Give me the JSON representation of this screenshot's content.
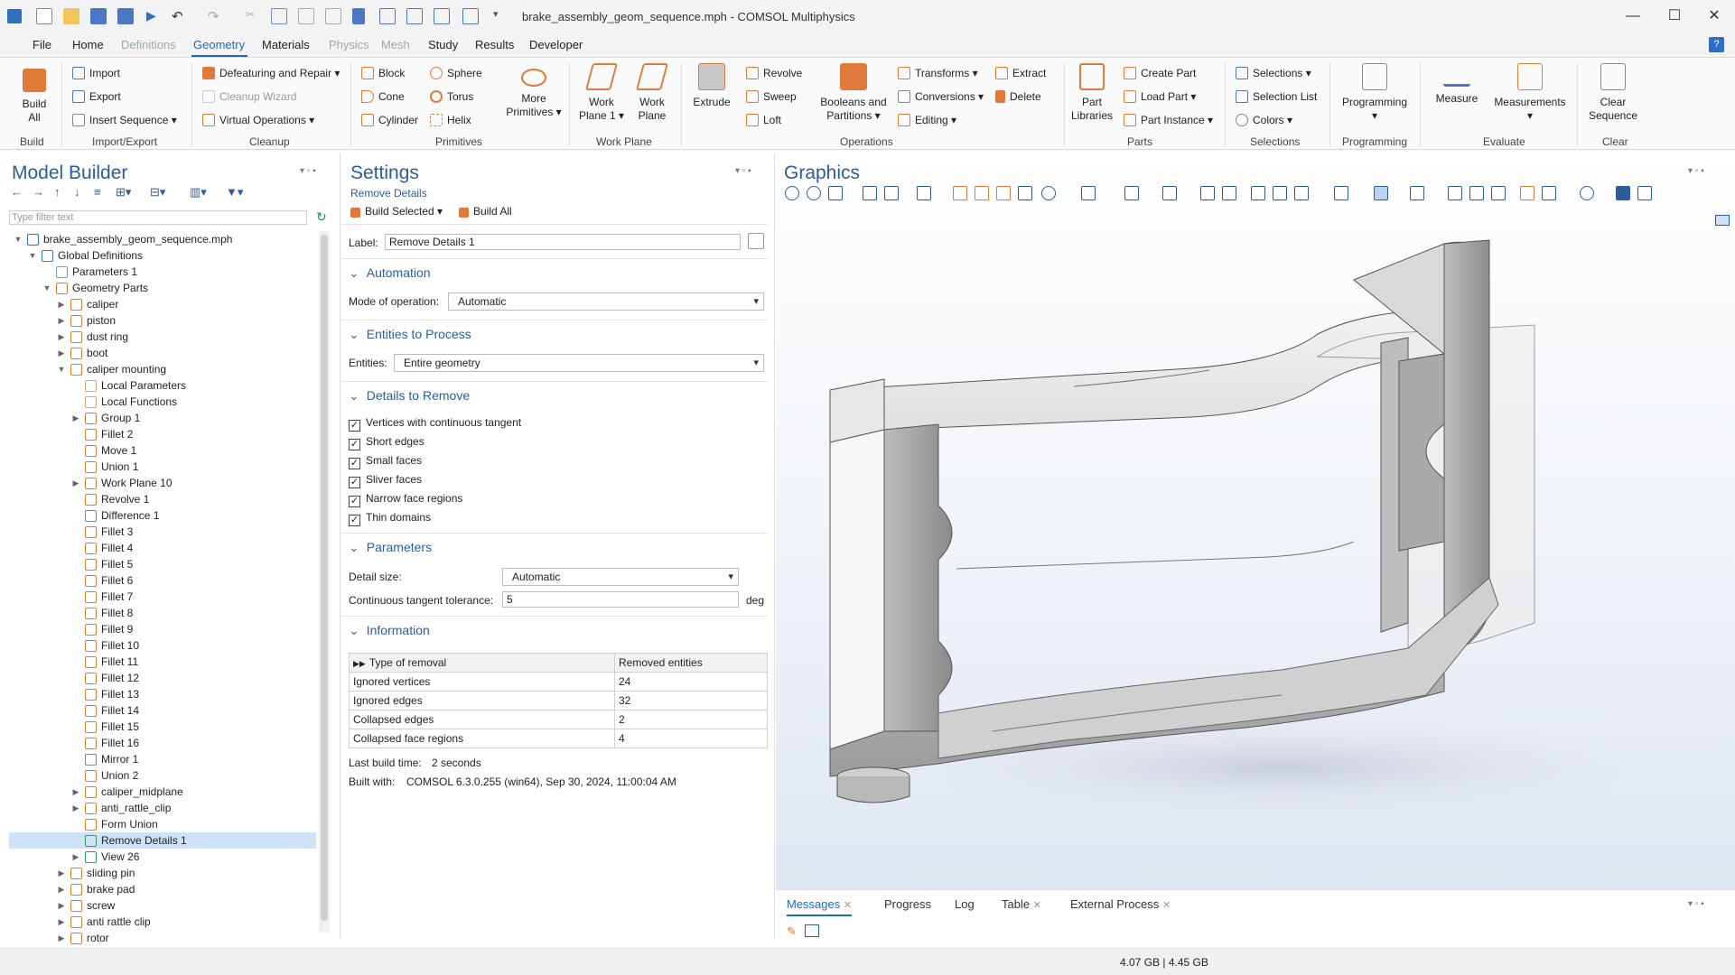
{
  "window": {
    "title": "brake_assembly_geom_sequence.mph - COMSOL Multiphysics"
  },
  "menu": [
    "File",
    "Home",
    "Definitions",
    "Geometry",
    "Materials",
    "Physics",
    "Mesh",
    "Study",
    "Results",
    "Developer"
  ],
  "ribbon": {
    "build": {
      "build_all": "Build\nAll",
      "group": "Build"
    },
    "import_export": {
      "import": "Import",
      "export": "Export",
      "insert_sequence": "Insert Sequence",
      "group": "Import/Export"
    },
    "cleanup": {
      "defeaturing": "Defeaturing and Repair",
      "cleanup_wizard": "Cleanup Wizard",
      "virtual_operations": "Virtual Operations",
      "group": "Cleanup"
    },
    "primitives": {
      "block": "Block",
      "cone": "Cone",
      "cylinder": "Cylinder",
      "sphere": "Sphere",
      "torus": "Torus",
      "helix": "Helix",
      "more": "More\nPrimitives",
      "group": "Primitives"
    },
    "work_plane": {
      "wp1": "Work\nPlane 1",
      "wp": "Work\nPlane",
      "group": "Work Plane"
    },
    "operations": {
      "extrude": "Extrude",
      "revolve": "Revolve",
      "sweep": "Sweep",
      "loft": "Loft",
      "booleans": "Booleans and\nPartitions",
      "transforms": "Transforms",
      "conversions": "Conversions",
      "editing": "Editing",
      "extract": "Extract",
      "delete": "Delete",
      "group": "Operations"
    },
    "parts": {
      "part_libraries": "Part\nLibraries",
      "create_part": "Create Part",
      "load_part": "Load Part",
      "part_instance": "Part Instance",
      "group": "Parts"
    },
    "selections": {
      "selections": "Selections",
      "selection_list": "Selection List",
      "colors": "Colors",
      "group": "Selections"
    },
    "programming": {
      "programming": "Programming",
      "group": "Programming"
    },
    "evaluate": {
      "measure": "Measure",
      "measurements": "Measurements",
      "group": "Evaluate"
    },
    "clear": {
      "clear_sequence": "Clear\nSequence",
      "group": "Clear"
    }
  },
  "model_builder": {
    "title": "Model Builder",
    "filter_placeholder": "Type filter text",
    "tree": [
      {
        "label": "brake_assembly_geom_sequence.mph",
        "indent": 0,
        "exp": "open",
        "icon": "#2e6fc4"
      },
      {
        "label": "Global Definitions",
        "indent": 1,
        "exp": "open",
        "icon": "#3a7bd5"
      },
      {
        "label": "Parameters 1",
        "indent": 2,
        "exp": "",
        "icon": "#7a9cc9"
      },
      {
        "label": "Geometry Parts",
        "indent": 2,
        "exp": "open",
        "icon": "#e07a3a"
      },
      {
        "label": "caliper",
        "indent": 3,
        "exp": "closed",
        "icon": "#e07a3a"
      },
      {
        "label": "piston",
        "indent": 3,
        "exp": "closed",
        "icon": "#e07a3a"
      },
      {
        "label": "dust ring",
        "indent": 3,
        "exp": "closed",
        "icon": "#e07a3a"
      },
      {
        "label": "boot",
        "indent": 3,
        "exp": "closed",
        "icon": "#e07a3a"
      },
      {
        "label": "caliper mounting",
        "indent": 3,
        "exp": "open",
        "icon": "#e07a3a"
      },
      {
        "label": "Local Parameters",
        "indent": 4,
        "exp": "",
        "icon": "#e0a07a"
      },
      {
        "label": "Local Functions",
        "indent": 4,
        "exp": "",
        "icon": "#e0a07a"
      },
      {
        "label": "Group 1",
        "indent": 4,
        "exp": "closed",
        "icon": "#e07a3a"
      },
      {
        "label": "Fillet 2",
        "indent": 4,
        "exp": "",
        "icon": "#e07a3a"
      },
      {
        "label": "Move 1",
        "indent": 4,
        "exp": "",
        "icon": "#e07a3a"
      },
      {
        "label": "Union 1",
        "indent": 4,
        "exp": "",
        "icon": "#e07a3a"
      },
      {
        "label": "Work Plane 10",
        "indent": 4,
        "exp": "closed",
        "icon": "#e07a3a"
      },
      {
        "label": "Revolve 1",
        "indent": 4,
        "exp": "",
        "icon": "#e07a3a"
      },
      {
        "label": "Difference 1",
        "indent": 4,
        "exp": "",
        "icon": "#888888"
      },
      {
        "label": "Fillet 3",
        "indent": 4,
        "exp": "",
        "icon": "#e07a3a"
      },
      {
        "label": "Fillet 4",
        "indent": 4,
        "exp": "",
        "icon": "#e07a3a"
      },
      {
        "label": "Fillet 5",
        "indent": 4,
        "exp": "",
        "icon": "#e07a3a"
      },
      {
        "label": "Fillet 6",
        "indent": 4,
        "exp": "",
        "icon": "#e07a3a"
      },
      {
        "label": "Fillet 7",
        "indent": 4,
        "exp": "",
        "icon": "#e07a3a"
      },
      {
        "label": "Fillet 8",
        "indent": 4,
        "exp": "",
        "icon": "#e07a3a"
      },
      {
        "label": "Fillet 9",
        "indent": 4,
        "exp": "",
        "icon": "#e07a3a"
      },
      {
        "label": "Fillet 10",
        "indent": 4,
        "exp": "",
        "icon": "#e07a3a"
      },
      {
        "label": "Fillet 11",
        "indent": 4,
        "exp": "",
        "icon": "#e07a3a"
      },
      {
        "label": "Fillet 12",
        "indent": 4,
        "exp": "",
        "icon": "#e07a3a"
      },
      {
        "label": "Fillet 13",
        "indent": 4,
        "exp": "",
        "icon": "#e07a3a"
      },
      {
        "label": "Fillet 14",
        "indent": 4,
        "exp": "",
        "icon": "#e07a3a"
      },
      {
        "label": "Fillet 15",
        "indent": 4,
        "exp": "",
        "icon": "#e07a3a"
      },
      {
        "label": "Fillet 16",
        "indent": 4,
        "exp": "",
        "icon": "#e07a3a"
      },
      {
        "label": "Mirror 1",
        "indent": 4,
        "exp": "",
        "icon": "#888888"
      },
      {
        "label": "Union 2",
        "indent": 4,
        "exp": "",
        "icon": "#e07a3a"
      },
      {
        "label": "caliper_midplane",
        "indent": 4,
        "exp": "closed",
        "icon": "#e07a3a"
      },
      {
        "label": "anti_rattle_clip",
        "indent": 4,
        "exp": "closed",
        "icon": "#e07a3a"
      },
      {
        "label": "Form Union",
        "indent": 4,
        "exp": "",
        "icon": "#e07a3a"
      },
      {
        "label": "Remove Details 1",
        "indent": 4,
        "exp": "",
        "icon": "#3a9a5a",
        "selected": true
      },
      {
        "label": "View 26",
        "indent": 4,
        "exp": "closed",
        "icon": "#3a9a5a"
      },
      {
        "label": "sliding pin",
        "indent": 3,
        "exp": "closed",
        "icon": "#e07a3a"
      },
      {
        "label": "brake pad",
        "indent": 3,
        "exp": "closed",
        "icon": "#e07a3a"
      },
      {
        "label": "screw",
        "indent": 3,
        "exp": "closed",
        "icon": "#e07a3a"
      },
      {
        "label": "anti rattle clip",
        "indent": 3,
        "exp": "closed",
        "icon": "#e07a3a"
      },
      {
        "label": "rotor",
        "indent": 3,
        "exp": "closed",
        "icon": "#e07a3a"
      }
    ]
  },
  "settings": {
    "title": "Settings",
    "subtitle": "Remove Details",
    "build_selected": "Build Selected",
    "build_all": "Build All",
    "label_caption": "Label:",
    "label_value": "Remove Details 1",
    "automation": {
      "heading": "Automation",
      "mode_caption": "Mode of operation:",
      "mode_value": "Automatic"
    },
    "entities": {
      "heading": "Entities to Process",
      "caption": "Entities:",
      "value": "Entire geometry"
    },
    "details": {
      "heading": "Details to Remove",
      "items": [
        "Vertices with continuous tangent",
        "Short edges",
        "Small faces",
        "Sliver faces",
        "Narrow face regions",
        "Thin domains"
      ]
    },
    "parameters": {
      "heading": "Parameters",
      "detail_size_caption": "Detail size:",
      "detail_size_value": "Automatic",
      "tolerance_caption": "Continuous tangent tolerance:",
      "tolerance_value": "5",
      "tolerance_unit": "deg"
    },
    "information": {
      "heading": "Information",
      "columns": [
        "Type of removal",
        "Removed entities"
      ],
      "rows": [
        [
          "Ignored vertices",
          "24"
        ],
        [
          "Ignored edges",
          "32"
        ],
        [
          "Collapsed edges",
          "2"
        ],
        [
          "Collapsed face regions",
          "4"
        ]
      ],
      "last_build_caption": "Last build time:",
      "last_build_value": "2 seconds",
      "built_with_caption": "Built with:",
      "built_with_value": "COMSOL 6.3.0.255 (win64), Sep 30, 2024, 11:00:04 AM"
    }
  },
  "graphics": {
    "title": "Graphics"
  },
  "messages": {
    "tabs": [
      "Messages",
      "Progress",
      "Log",
      "Table",
      "External Process"
    ]
  },
  "status": {
    "memory": "4.07 GB | 4.45 GB"
  },
  "colors": {
    "accent": "#2a5d9b",
    "selection": "#cfe3f7",
    "orange": "#e07a3a"
  }
}
